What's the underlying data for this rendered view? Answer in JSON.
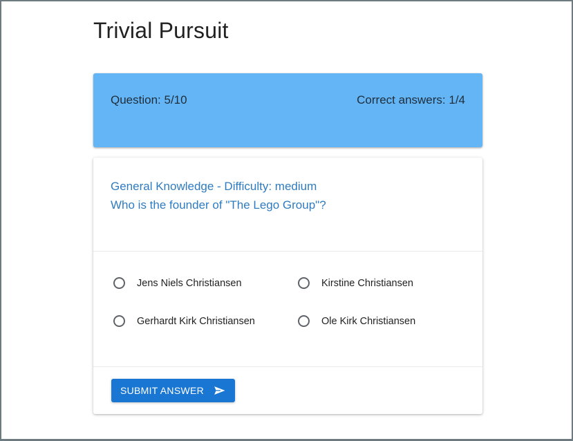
{
  "app": {
    "title": "Trivial Pursuit"
  },
  "status": {
    "question_progress": "Question: 5/10",
    "correct_answers": "Correct answers: 1/4"
  },
  "question": {
    "category_line": "General Knowledge - Difficulty: medium",
    "text": "Who is the founder of \"The Lego Group\"?",
    "options": [
      {
        "label": "Jens Niels Christiansen",
        "selected": false
      },
      {
        "label": "Kirstine Christiansen",
        "selected": false
      },
      {
        "label": "Gerhardt Kirk Christiansen",
        "selected": false
      },
      {
        "label": "Ole Kirk Christiansen",
        "selected": false
      }
    ]
  },
  "actions": {
    "submit_label": "SUBMIT ANSWER",
    "submit_icon": "send-icon"
  },
  "colors": {
    "status_card": "#64b5f6",
    "accent": "#1976d2",
    "question_text": "#2f7bc0"
  }
}
